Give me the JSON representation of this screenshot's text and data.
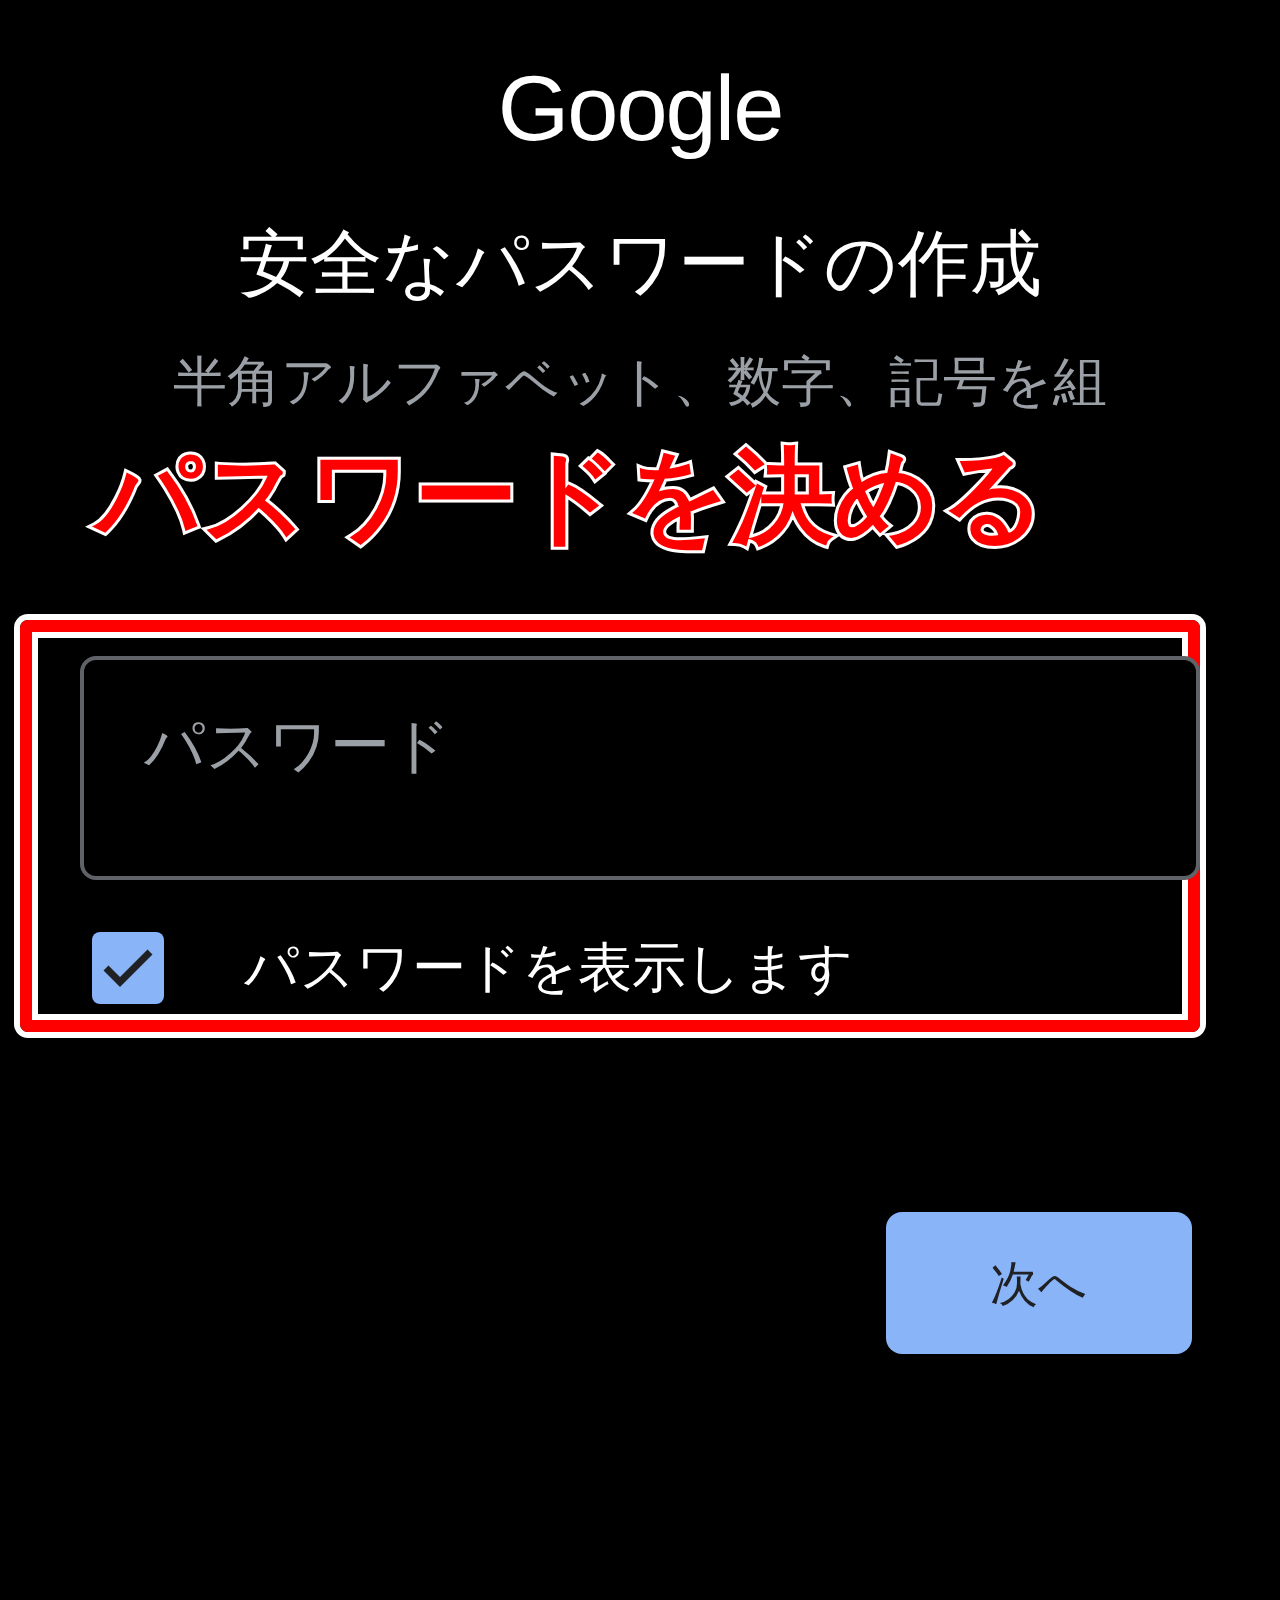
{
  "logo": "Google",
  "title": "安全なパスワードの作成",
  "description": "半角アルファベット、数字、記号を組",
  "annotation": {
    "text": "パスワードを決める",
    "color": "#ff0000"
  },
  "password_field": {
    "placeholder": "パスワード"
  },
  "show_password": {
    "label": "パスワードを表示します",
    "checked": true
  },
  "next_button": "次へ"
}
